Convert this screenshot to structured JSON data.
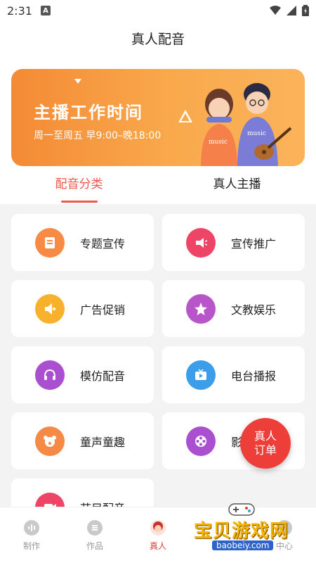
{
  "status": {
    "time": "2:31",
    "badge": "A"
  },
  "header": {
    "title": "真人配音"
  },
  "banner": {
    "headline": "主播工作时间",
    "hours": "周一至周五 早9:00–晚18:00",
    "shirt_text": "music"
  },
  "tabs": [
    {
      "label": "配音分类"
    },
    {
      "label": "真人主播"
    }
  ],
  "categories": [
    {
      "label": "专题宣传",
      "color": "#f78a45"
    },
    {
      "label": "宣传推广",
      "color": "#ee4466"
    },
    {
      "label": "广告促销",
      "color": "#f8b12c"
    },
    {
      "label": "文教娱乐",
      "color": "#b856c9"
    },
    {
      "label": "模仿配音",
      "color": "#a94fd0"
    },
    {
      "label": "电台播报",
      "color": "#3c9de8"
    },
    {
      "label": "童声童趣",
      "color": "#f48a45"
    },
    {
      "label": "影",
      "color": "#a94fd0"
    },
    {
      "label": "节目配音",
      "color": "#ee4466"
    }
  ],
  "fab": {
    "line1": "真人",
    "line2": "订单"
  },
  "bottom_nav": [
    {
      "label": "制作",
      "icon": "waveform-icon"
    },
    {
      "label": "作品",
      "icon": "list-icon"
    },
    {
      "label": "真人",
      "icon": "avatar-icon"
    },
    {
      "label": "",
      "icon": ""
    },
    {
      "label": "中心",
      "icon": "user-icon"
    }
  ],
  "watermark": {
    "brand": "宝贝游戏网",
    "url": "baobeiy.com"
  },
  "colors": {
    "accent": "#f0564c",
    "banner": "#f9a94c",
    "fab": "#ee3e3a"
  }
}
